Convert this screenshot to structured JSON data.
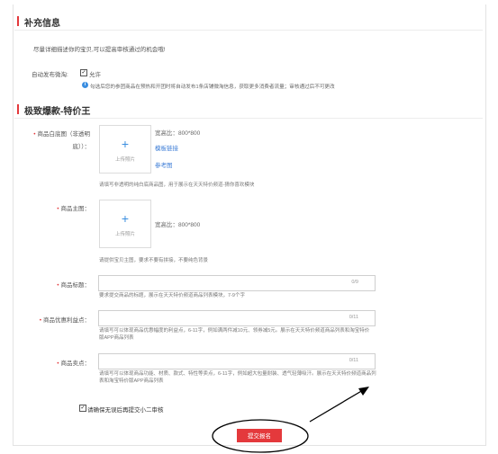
{
  "supplement": {
    "title": "补充信息",
    "desc": "尽量详细描述你的宝贝,可以提高审核通过的机会哦!",
    "weibo_label": "自动发布微淘:",
    "weibo_option": "允许",
    "weibo_note": "勾选后您的参团商品在预热和开团时将自动发布1条店铺微淘信息，获取更多消费者流量；审核通过后不可更改"
  },
  "section2": {
    "title": "极致爆款-特价王"
  },
  "white_image": {
    "label_line1": "商品白底图（非透明",
    "label_line2": "底））：",
    "upload_text": "上传照片",
    "ratio": "宽高比：800*800",
    "template_link": "模板链接",
    "ref_link": "参考图",
    "hint": "请填写非透明的纯白底商品图，用于展示在天天特价频道-猜你喜欢模块"
  },
  "main_image": {
    "label": "商品主图：",
    "upload_text": "上传照片",
    "ratio": "宽高比：800*800",
    "hint": "请提供宝贝主图，要求不要有拼接，不要纯色背景"
  },
  "title_field": {
    "label": "商品标题：",
    "count": "0/9",
    "hint": "要求提交商品的标题，展示在天天特价频道商品列表模块，7-9个字"
  },
  "benefit_field": {
    "label": "商品优惠利益点：",
    "count": "0/11",
    "hint": "请填写可以体现商品优惠幅度的利益点，6-11字，例如满两件减10元、领券减5元。展示在天天特价频道商品列表和淘宝特价版APP商品列表"
  },
  "selling_field": {
    "label": "商品卖点：",
    "count": "0/11",
    "hint": "请填写可以体现商品功能、材质、款式、特性等卖点，6-11字，例如超大包量耐装、透气轻薄吸汗。展示在天天特价频道商品列表和淘宝特价版APP商品列表"
  },
  "confirm": {
    "label": "请确保无误后再提交小二审核"
  },
  "submit": {
    "label": "提交报名"
  }
}
